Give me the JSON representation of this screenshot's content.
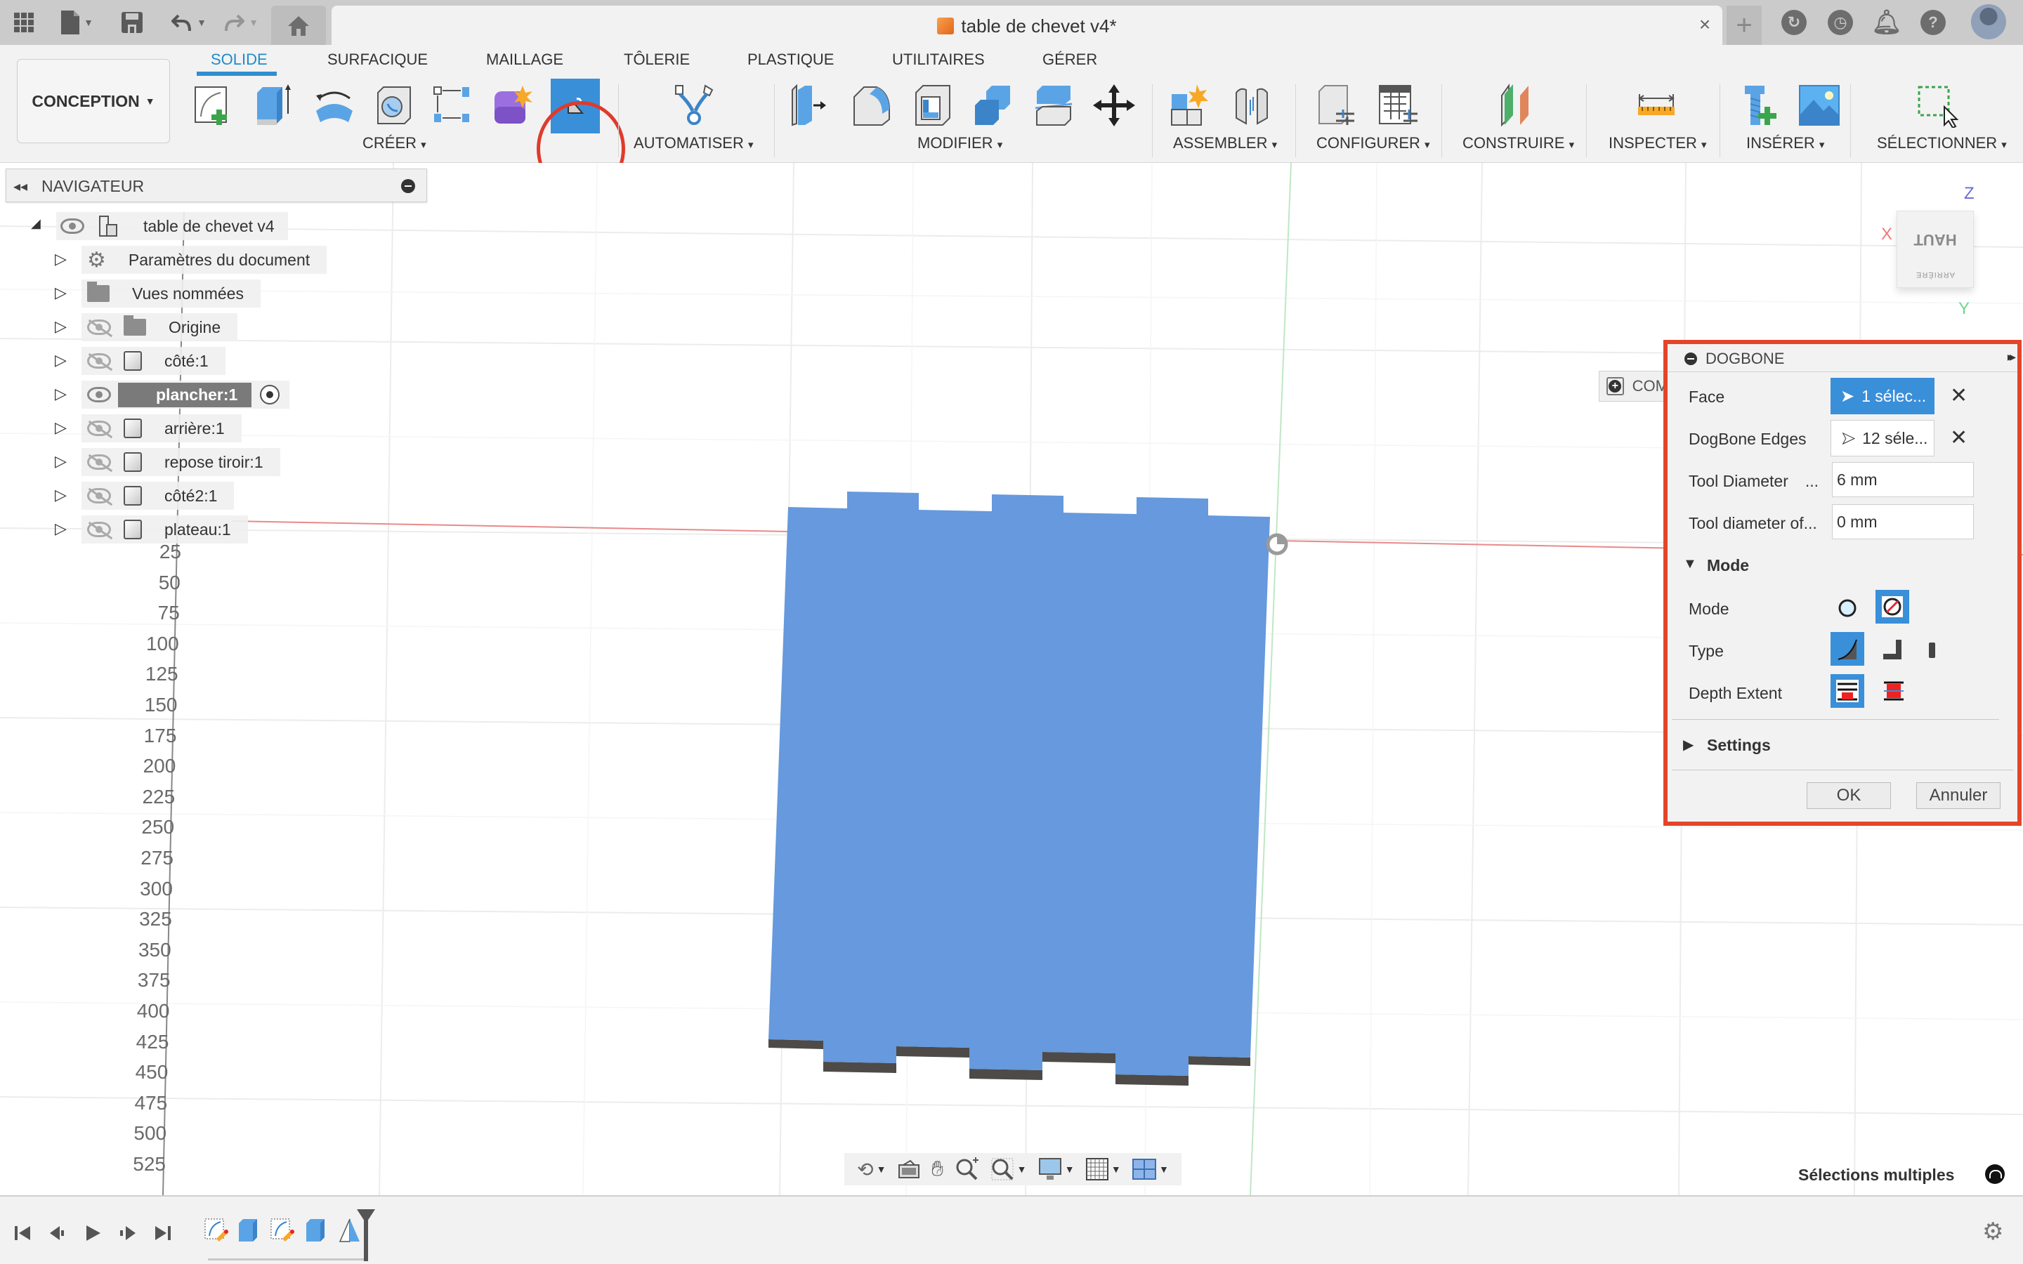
{
  "titlebar": {
    "document_title": "table de chevet v4*",
    "icons": [
      "app-grid-icon",
      "file-icon",
      "save-icon",
      "undo-icon",
      "redo-icon",
      "home-icon",
      "new-tab-icon",
      "extensions-icon",
      "job-status-icon",
      "notifications-icon",
      "help-icon",
      "avatar"
    ]
  },
  "ribbon": {
    "workspace": "CONCEPTION",
    "tabs": [
      {
        "label": "SOLIDE",
        "active": true
      },
      {
        "label": "SURFACIQUE",
        "active": false
      },
      {
        "label": "MAILLAGE",
        "active": false
      },
      {
        "label": "TÔLERIE",
        "active": false
      },
      {
        "label": "PLASTIQUE",
        "active": false
      },
      {
        "label": "UTILITAIRES",
        "active": false
      },
      {
        "label": "GÉRER",
        "active": false
      }
    ],
    "groups": {
      "create": "CRÉER",
      "automate": "AUTOMATISER",
      "modify": "MODIFIER",
      "assemble": "ASSEMBLER",
      "configure": "CONFIGURER",
      "construct": "CONSTRUIRE",
      "inspect": "INSPECTER",
      "insert": "INSÉRER",
      "select": "SÉLECTIONNER"
    },
    "caret": "▾",
    "highlighted_tool": "dogbone"
  },
  "navigator": {
    "title": "NAVIGATEUR",
    "root": "table de chevet v4",
    "items": [
      {
        "label": "Paramètres du document",
        "icon": "gear",
        "visible": null
      },
      {
        "label": "Vues nommées",
        "icon": "folder",
        "visible": null
      },
      {
        "label": "Origine",
        "icon": "folder",
        "visible": false
      },
      {
        "label": "côté:1",
        "icon": "body",
        "visible": false
      },
      {
        "label": "plancher:1",
        "icon": "body",
        "visible": true,
        "selected": true
      },
      {
        "label": "arrière:1",
        "icon": "body",
        "visible": false
      },
      {
        "label": "repose tiroir:1",
        "icon": "body",
        "visible": false
      },
      {
        "label": "côté2:1",
        "icon": "body",
        "visible": false
      },
      {
        "label": "plateau:1",
        "icon": "body",
        "visible": false
      }
    ]
  },
  "viewport": {
    "ruler_labels": [
      "25",
      "50",
      "75",
      "100",
      "125",
      "150",
      "175",
      "200",
      "225",
      "250",
      "275",
      "300",
      "325",
      "350",
      "375",
      "400",
      "425",
      "450",
      "475",
      "500",
      "525"
    ],
    "comments_label": "COM",
    "viewcube": {
      "face": "HAUT",
      "side": "ARRIÈRE",
      "axes": {
        "x": "X",
        "y": "Y",
        "z": "Z"
      }
    },
    "status": "Sélections multiples",
    "colors": {
      "part": "#6699dd",
      "part_edge": "#4a4a4a",
      "x_axis": "#e88a8a"
    }
  },
  "dogbone": {
    "title": "DOGBONE",
    "face_label": "Face",
    "face_value": "1 sélec...",
    "edges_label": "DogBone Edges",
    "edges_value": "12 séle...",
    "tool_diameter_label": "Tool Diameter",
    "tool_diameter_ellipsis": "...",
    "tool_diameter_value": "6 mm",
    "tool_offset_label": "Tool diameter of...",
    "tool_offset_value": "0 mm",
    "mode_section": "Mode",
    "mode_label": "Mode",
    "type_label": "Type",
    "depth_label": "Depth Extent",
    "settings_section": "Settings",
    "ok": "OK",
    "cancel": "Annuler",
    "clear": "✕",
    "accent": "#3a8fd9",
    "highlight": "#e4452a"
  }
}
